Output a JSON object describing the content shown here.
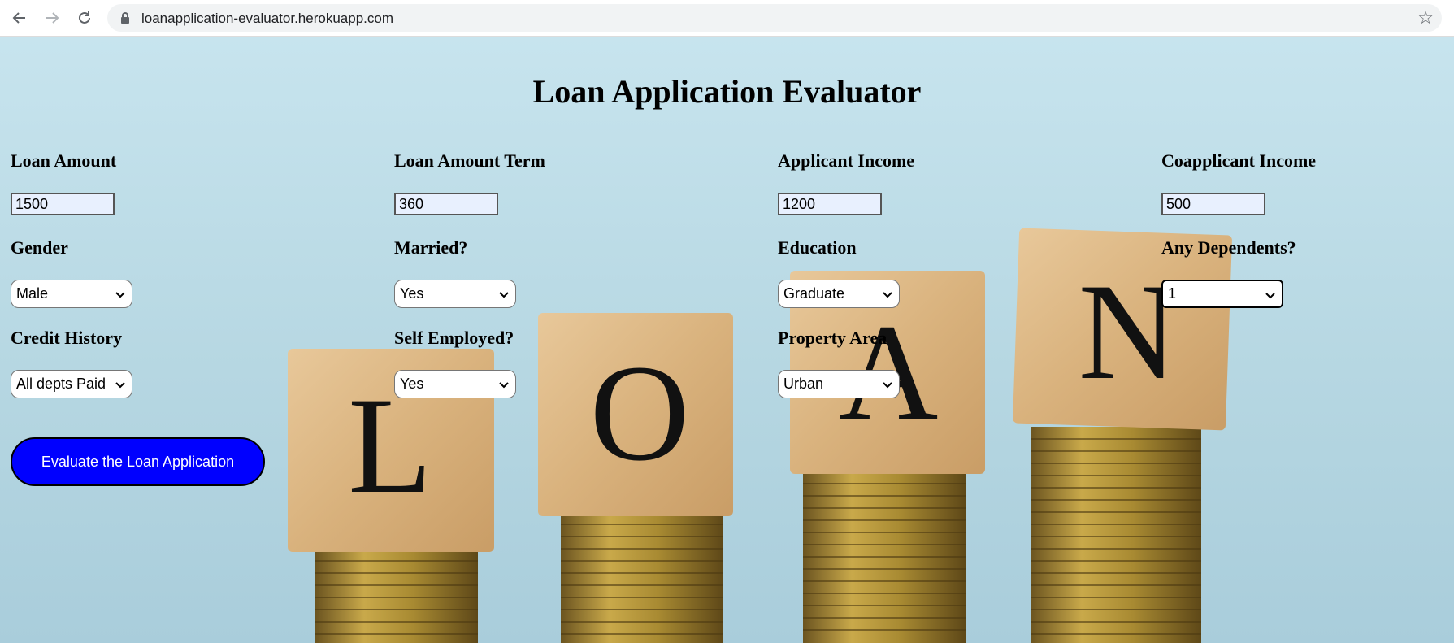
{
  "browser": {
    "url": "loanapplication-evaluator.herokuapp.com"
  },
  "page": {
    "title": "Loan Application Evaluator",
    "background_letters": [
      "L",
      "O",
      "A",
      "N"
    ]
  },
  "form": {
    "loan_amount": {
      "label": "Loan Amount",
      "value": "1500"
    },
    "loan_amount_term": {
      "label": "Loan Amount Term",
      "value": "360"
    },
    "applicant_income": {
      "label": "Applicant Income",
      "value": "1200"
    },
    "coapplicant_income": {
      "label": "Coapplicant Income",
      "value": "500"
    },
    "gender": {
      "label": "Gender",
      "selected": "Male"
    },
    "married": {
      "label": "Married?",
      "selected": "Yes"
    },
    "education": {
      "label": "Education",
      "selected": "Graduate"
    },
    "dependents": {
      "label": "Any Dependents?",
      "selected": "1"
    },
    "credit_history": {
      "label": "Credit History",
      "selected": "All depts Paid"
    },
    "self_employed": {
      "label": "Self Employed?",
      "selected": "Yes"
    },
    "property_area": {
      "label": "Property Area",
      "selected": "Urban"
    },
    "submit_label": "Evaluate the Loan Application"
  },
  "colors": {
    "button_bg": "#0000ff",
    "input_bg": "#e8f0fe"
  }
}
